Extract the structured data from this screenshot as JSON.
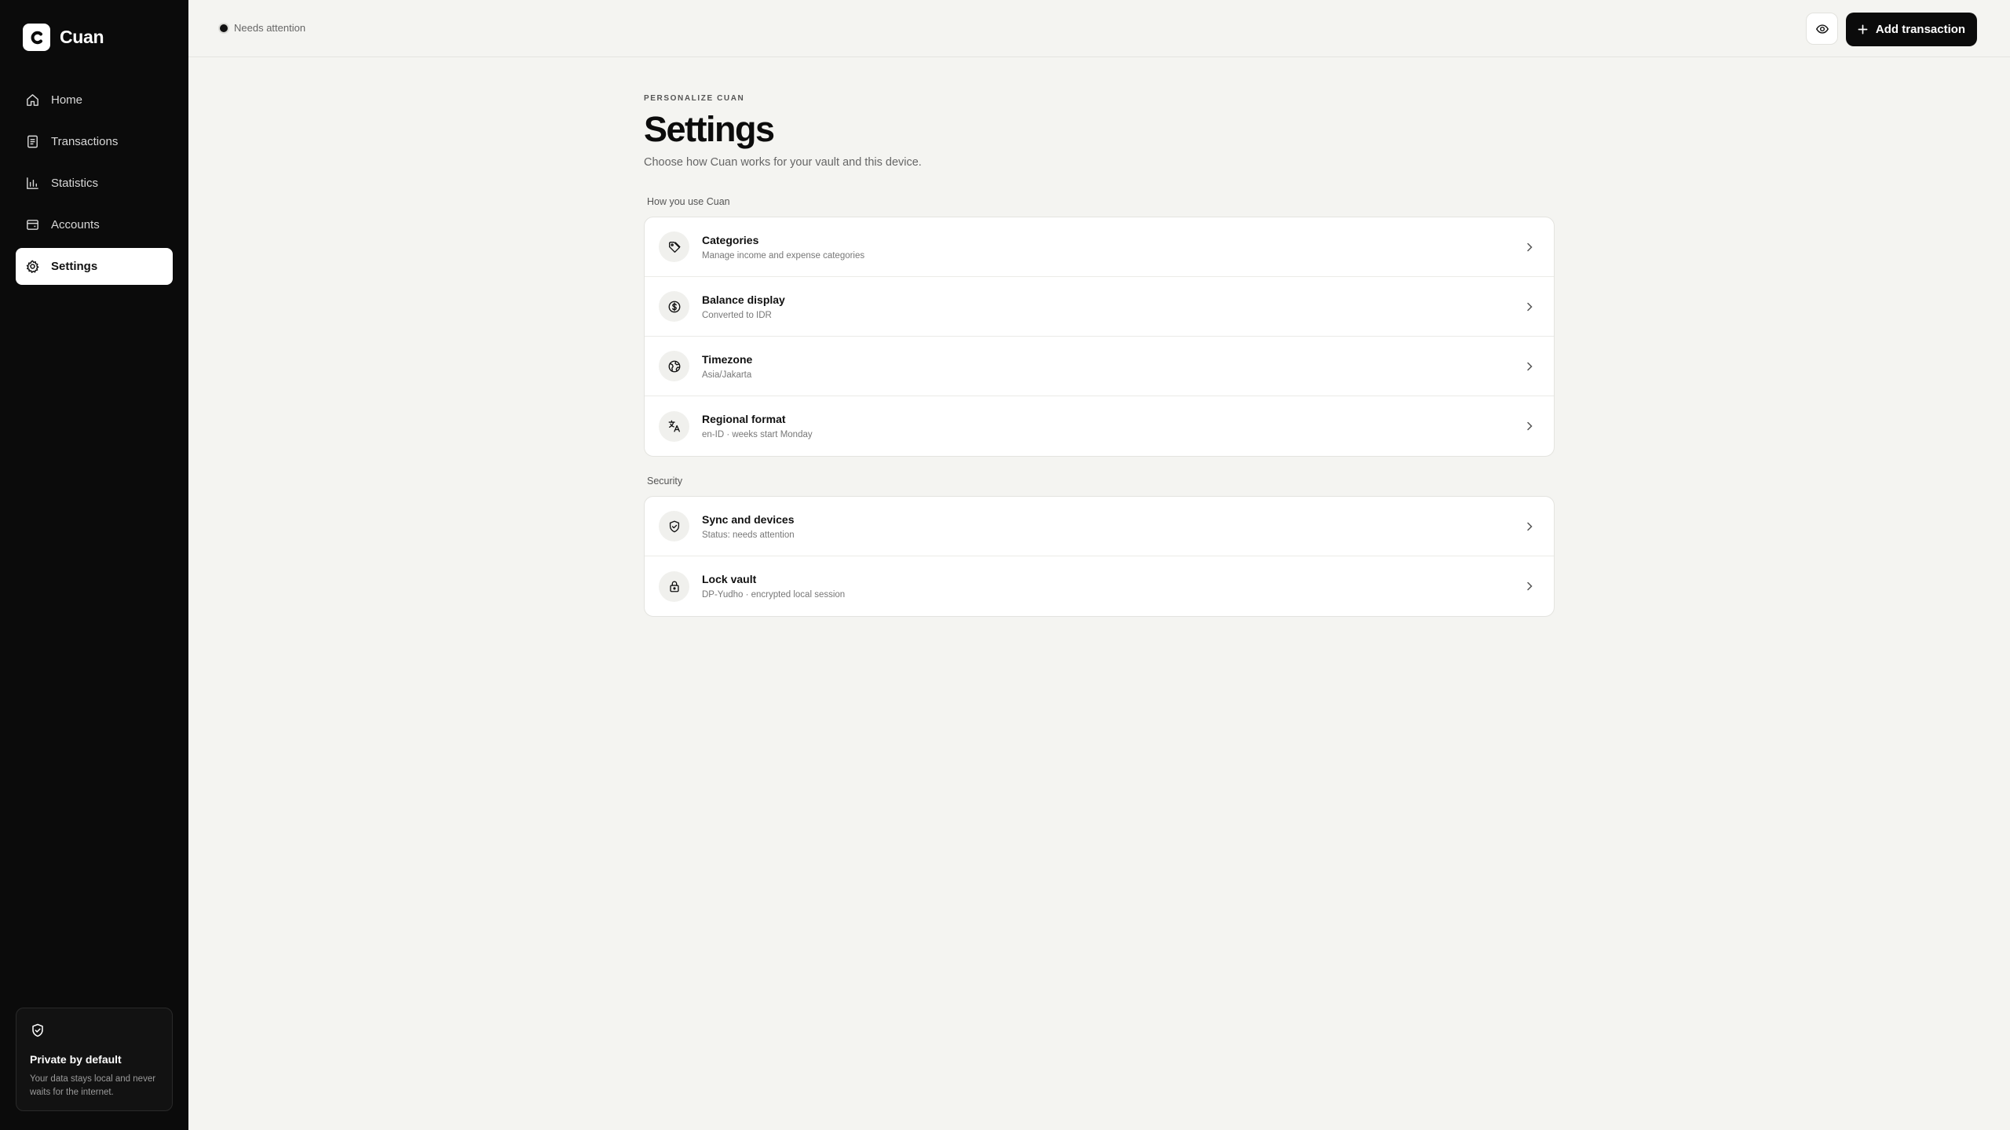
{
  "app": {
    "name": "Cuan"
  },
  "sidebar": {
    "items": [
      {
        "label": "Home",
        "icon": "home-icon"
      },
      {
        "label": "Transactions",
        "icon": "receipt-icon"
      },
      {
        "label": "Statistics",
        "icon": "bar-chart-icon"
      },
      {
        "label": "Accounts",
        "icon": "wallet-icon"
      },
      {
        "label": "Settings",
        "icon": "gear-icon",
        "active": true
      }
    ],
    "privacy": {
      "title": "Private by default",
      "text": "Your data stays local and never waits for the internet."
    }
  },
  "topbar": {
    "status": "Needs attention",
    "add_label": "Add transaction"
  },
  "page": {
    "eyebrow": "PERSONALIZE CUAN",
    "title": "Settings",
    "subtitle": "Choose how Cuan works for your vault and this device."
  },
  "sections": [
    {
      "label": "How you use Cuan",
      "rows": [
        {
          "title": "Categories",
          "sub": "Manage income and expense categories",
          "icon": "tag-icon"
        },
        {
          "title": "Balance display",
          "sub": "Converted to IDR",
          "icon": "currency-icon"
        },
        {
          "title": "Timezone",
          "sub": "Asia/Jakarta",
          "icon": "globe-icon"
        },
        {
          "title": "Regional format",
          "sub": "en-ID · weeks start Monday",
          "icon": "language-icon"
        }
      ]
    },
    {
      "label": "Security",
      "rows": [
        {
          "title": "Sync and devices",
          "sub": "Status: needs attention",
          "icon": "shield-check-icon"
        },
        {
          "title": "Lock vault",
          "sub": "DP-Yudho · encrypted local session",
          "icon": "lock-icon"
        }
      ]
    }
  ],
  "colors": {
    "sidebar_bg": "#0b0b0b",
    "page_bg": "#f4f4f1",
    "accent": "#0b0b0b"
  }
}
